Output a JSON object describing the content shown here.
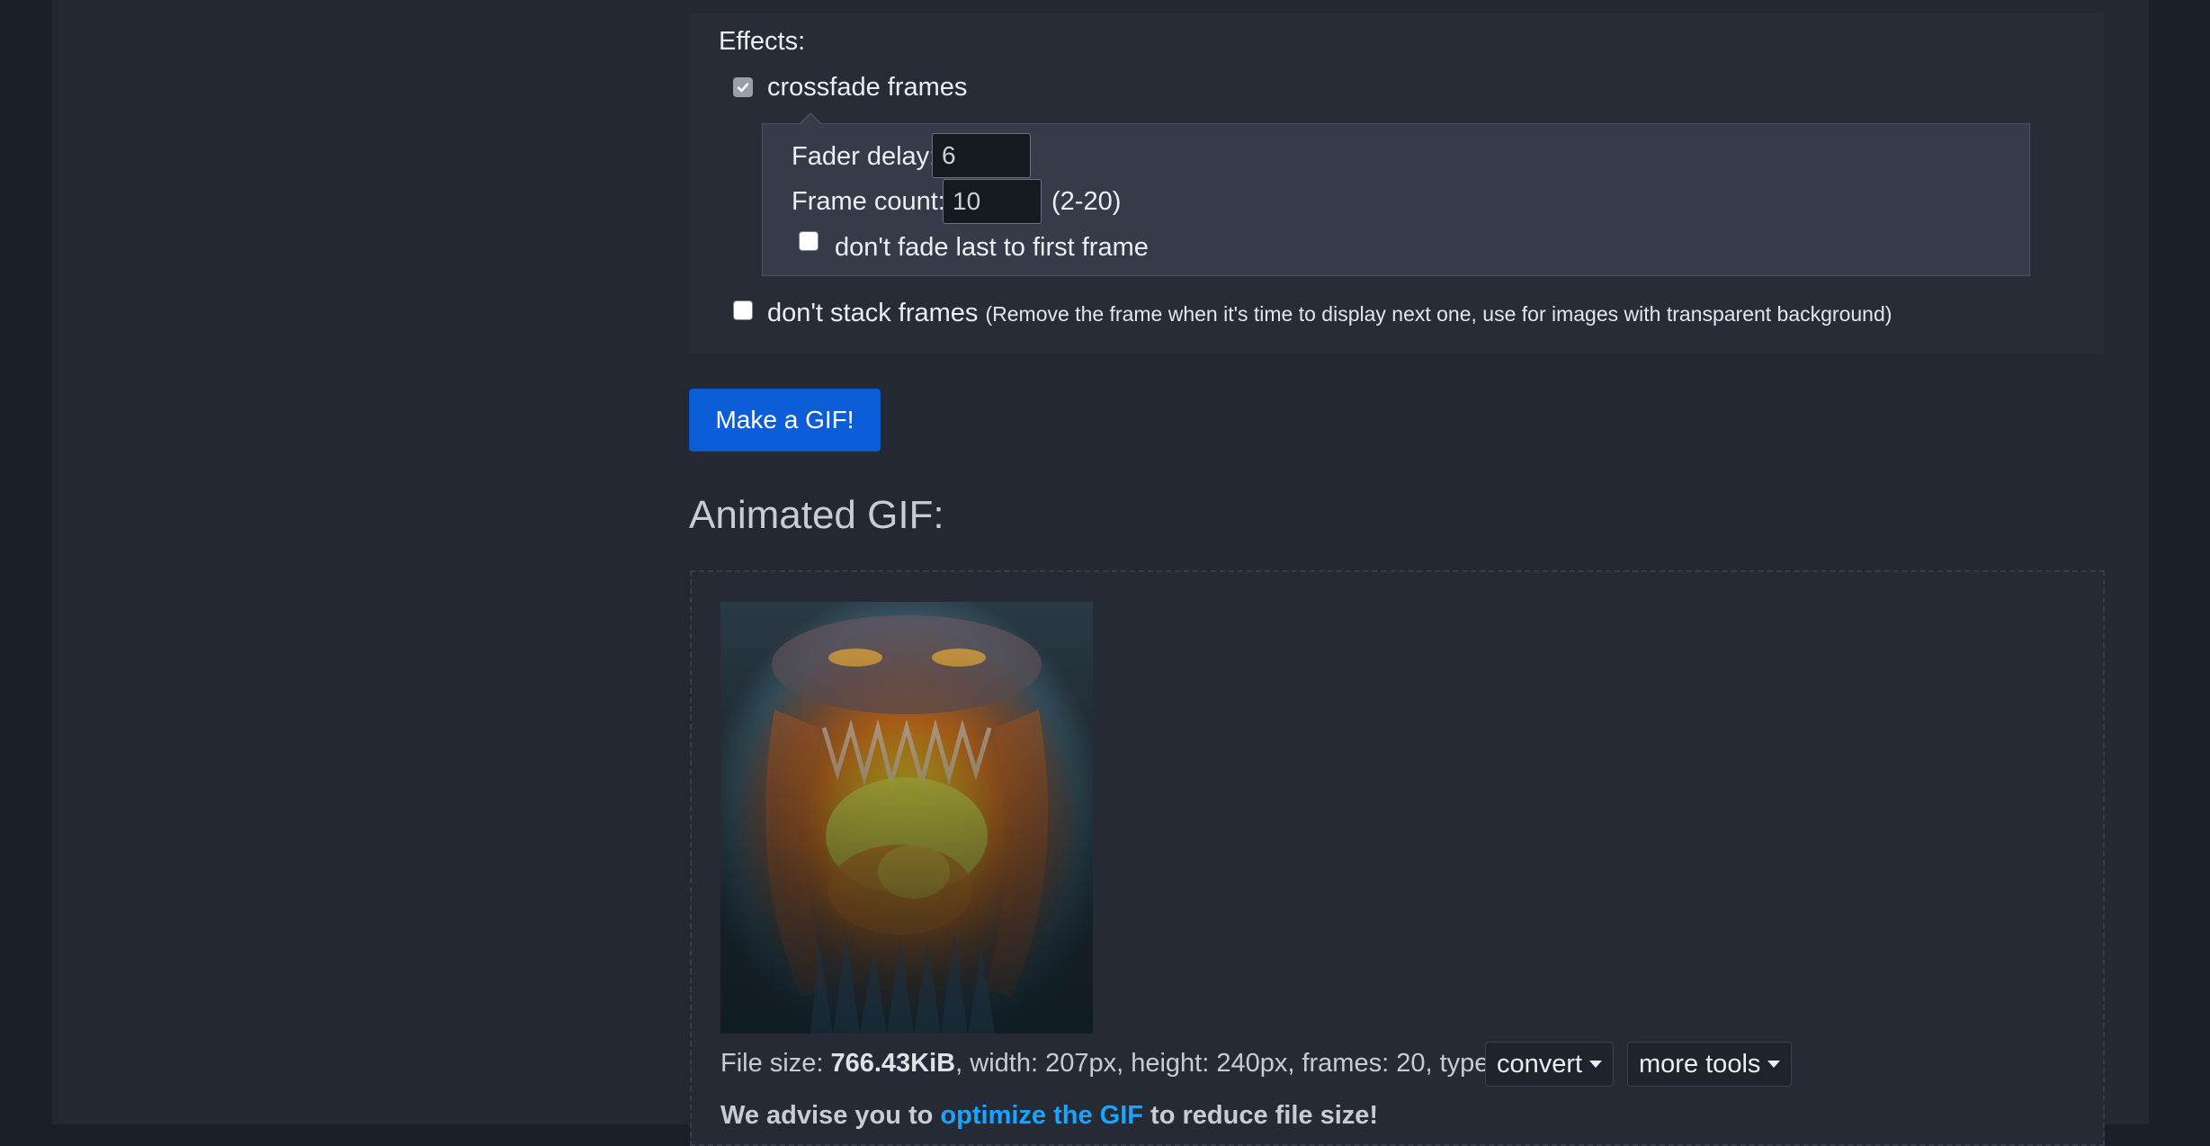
{
  "effects": {
    "heading": "Effects:",
    "crossfade": {
      "label": "crossfade frames",
      "checked": true
    },
    "fader": {
      "delay_label": "Fader delay:",
      "delay_value": "6",
      "count_label": "Frame count:",
      "count_value": "10",
      "count_hint": "(2-20)",
      "no_fade_last": {
        "label": "don't fade last to first frame",
        "checked": false
      }
    },
    "dont_stack": {
      "label": "don't stack frames",
      "note": "(Remove the frame when it's time to display next one, use for images with transparent background)",
      "checked": false
    }
  },
  "make_button": "Make a GIF!",
  "result": {
    "title": "Animated GIF:",
    "file_info": {
      "size_label": "File size: ",
      "size_value": "766.43KiB",
      "rest": ", width: 207px, height: 240px, frames: 20, type: gif"
    },
    "convert_label": "convert",
    "more_tools_label": "more tools",
    "advise_prefix": "We advise you to ",
    "advise_link": "optimize the GIF",
    "advise_suffix": " to reduce file size!"
  },
  "colors": {
    "accent_button": "#0b5ed7",
    "link": "#1aa3ff",
    "background": "#232833"
  }
}
